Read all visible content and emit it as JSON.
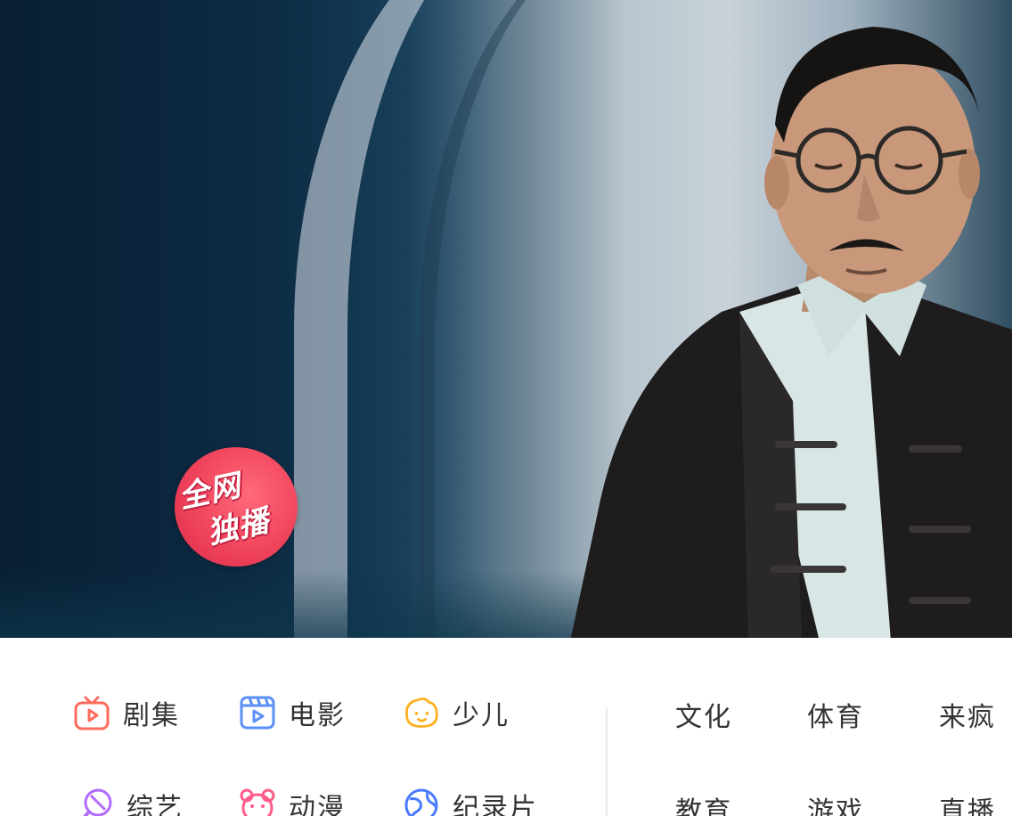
{
  "banner": {
    "badge_line1": "全网",
    "badge_line2": "独播"
  },
  "categories": [
    {
      "label": "剧集",
      "icon": "tv-play-icon",
      "color": "#ff6b5c"
    },
    {
      "label": "电影",
      "icon": "film-clapper-icon",
      "color": "#5b8ff9"
    },
    {
      "label": "少儿",
      "icon": "kid-face-icon",
      "color": "#ffb020"
    },
    {
      "label": "综艺",
      "icon": "microphone-icon",
      "color": "#b26bff"
    },
    {
      "label": "动漫",
      "icon": "bear-icon",
      "color": "#ff5c8a"
    },
    {
      "label": "纪录片",
      "icon": "globe-icon",
      "color": "#4a7bff"
    }
  ],
  "text_links": [
    {
      "label": "文化"
    },
    {
      "label": "体育"
    },
    {
      "label": "来疯"
    },
    {
      "label": "教育"
    },
    {
      "label": "游戏"
    },
    {
      "label": "直播"
    }
  ]
}
